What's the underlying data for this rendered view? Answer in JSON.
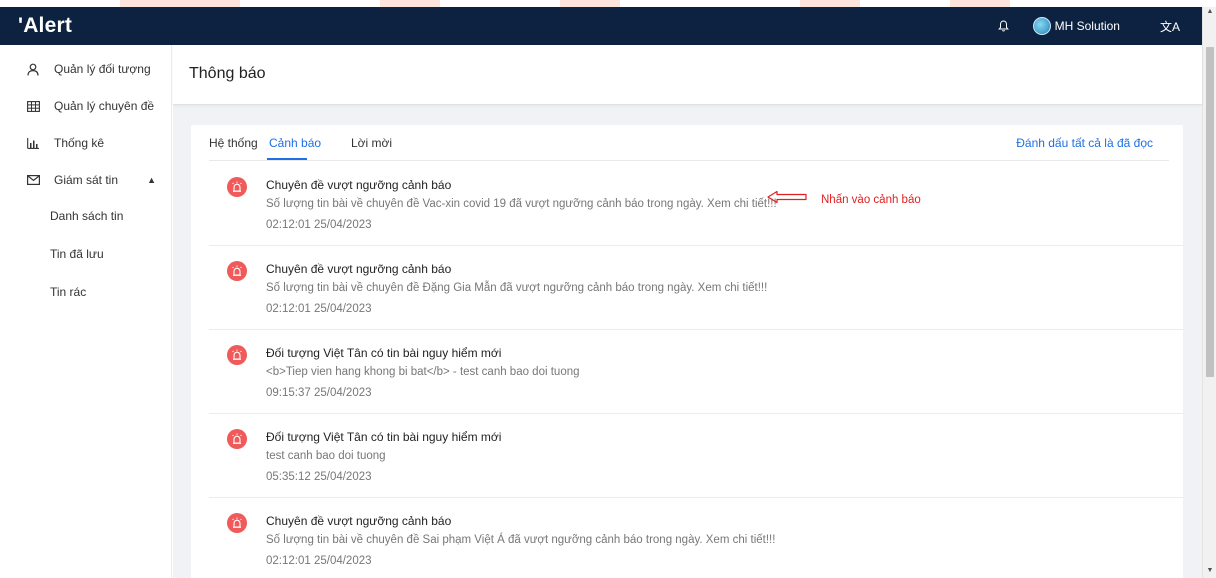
{
  "app": {
    "logo": "'Alert"
  },
  "header": {
    "user_name": "MH Solution",
    "lang_glyph": "文A"
  },
  "sidebar": {
    "items": [
      {
        "label": "Quản lý đối tượng",
        "icon": "person-icon"
      },
      {
        "label": "Quản lý chuyên đề",
        "icon": "grid-icon"
      },
      {
        "label": "Thống kê",
        "icon": "bar-chart-icon"
      },
      {
        "label": "Giám sát tin",
        "icon": "mail-icon"
      }
    ],
    "subitems": [
      {
        "label": "Danh sách tin"
      },
      {
        "label": "Tin đã lưu"
      },
      {
        "label": "Tin rác"
      }
    ]
  },
  "page": {
    "title": "Thông báo"
  },
  "tabs": [
    {
      "label": "Hệ thống"
    },
    {
      "label": "Cảnh báo"
    },
    {
      "label": "Lời mời"
    }
  ],
  "mark_all_read": "Đánh dấu tất cả là đã đọc",
  "callout": {
    "text": "Nhấn vào cảnh báo"
  },
  "notifications": [
    {
      "title": "Chuyên đề vượt ngưỡng cảnh báo",
      "body": "Số lượng tin bài về chuyên đề Vac-xin covid 19 đã vượt ngưỡng cảnh báo trong ngày. Xem chi tiết!!!",
      "time": "02:12:01 25/04/2023"
    },
    {
      "title": "Chuyên đề vượt ngưỡng cảnh báo",
      "body": "Số lượng tin bài về chuyên đề Đặng Gia Mẫn đã vượt ngưỡng cảnh báo trong ngày. Xem chi tiết!!!",
      "time": "02:12:01 25/04/2023"
    },
    {
      "title": "Đối tượng Việt Tân có tin bài nguy hiểm mới",
      "body": "<b>Tiep vien hang khong bi bat</b> - test canh bao doi tuong",
      "time": "09:15:37 25/04/2023"
    },
    {
      "title": "Đối tượng Việt Tân có tin bài nguy hiểm mới",
      "body": "test canh bao doi tuong",
      "time": "05:35:12 25/04/2023"
    },
    {
      "title": "Chuyên đề vượt ngưỡng cảnh báo",
      "body": "Số lượng tin bài về chuyên đề Sai phạm Việt Á đã vượt ngưỡng cảnh báo trong ngày. Xem chi tiết!!!",
      "time": "02:12:01 25/04/2023"
    }
  ],
  "colors": {
    "header_bg": "#0d2240",
    "accent": "#1f6fe5",
    "alert_red": "#f05a5a",
    "callout_red": "#e02020"
  }
}
